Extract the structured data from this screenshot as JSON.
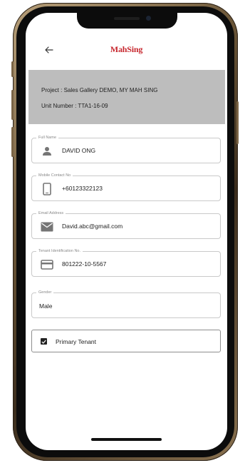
{
  "header": {
    "back_icon": "arrow-left-icon",
    "logo_text": "MahSing",
    "logo_color": "#c7282f"
  },
  "project": {
    "project_line": "Project : Sales Gallery DEMO, MY MAH SING",
    "unit_line": "Unit Number : TTA1-16-09"
  },
  "form": {
    "full_name": {
      "label": "Full Name",
      "value": "DAVID ONG",
      "icon": "person-icon"
    },
    "mobile": {
      "label": "Mobile Contact No",
      "value": "+60123322123",
      "icon": "phone-icon"
    },
    "email": {
      "label": "Email Address",
      "value": "David.abc@gmail.com",
      "icon": "mail-icon"
    },
    "tenant_id": {
      "label": "Tenant Identification No.",
      "value": "801222-10-5567",
      "icon": "card-icon"
    },
    "gender": {
      "label": "Gender",
      "value": "Male"
    },
    "primary_tenant": {
      "label": "Primary Tenant",
      "checked": true
    }
  }
}
